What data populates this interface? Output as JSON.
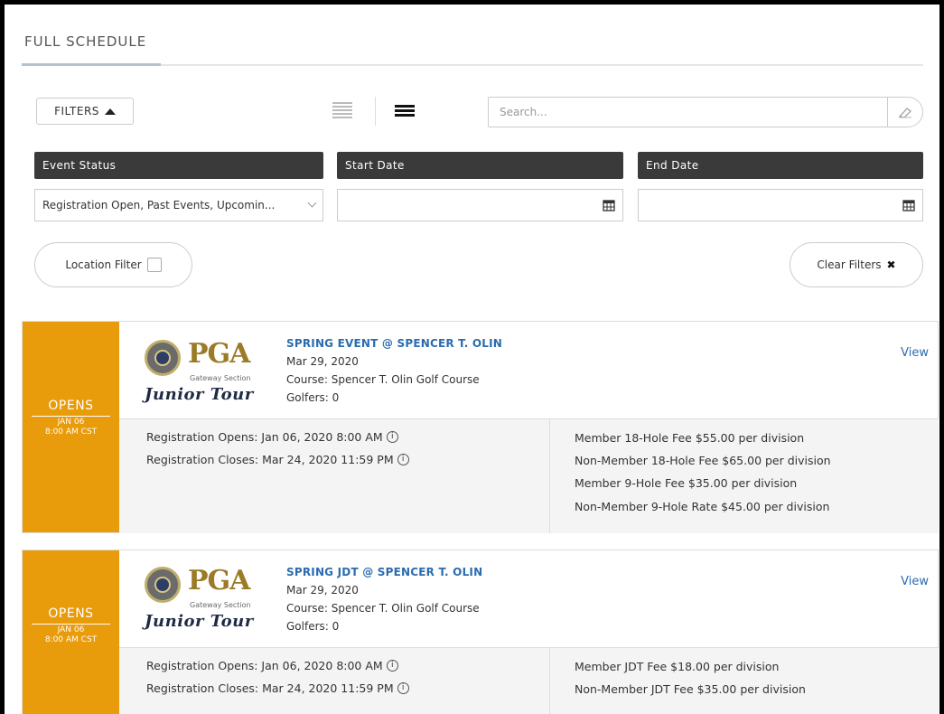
{
  "tab": {
    "title": "FULL SCHEDULE"
  },
  "toolbar": {
    "filters_label": "FILTERS",
    "search_placeholder": "Search..."
  },
  "filters": {
    "event_status_header": "Event Status",
    "start_date_header": "Start Date",
    "end_date_header": "End Date",
    "event_status_value": "Registration Open, Past Events, Upcomin...",
    "start_date_value": "",
    "end_date_value": "",
    "location_filter_label": "Location Filter",
    "clear_filters_label": "Clear Filters"
  },
  "events": [
    {
      "opens_label": "OPENS",
      "opens_date": "JAN 06",
      "opens_time": "8:00 AM CST",
      "logo_pga": "PGA",
      "logo_section": "Gateway Section",
      "logo_tour": "Junior Tour",
      "title": "SPRING EVENT @ SPENCER T. OLIN",
      "date": "Mar 29, 2020",
      "course": "Course: Spencer T. Olin Golf Course",
      "golfers": "Golfers: 0",
      "view_label": "View",
      "registration_opens": "Registration Opens: Jan 06, 2020 8:00 AM",
      "registration_closes": "Registration Closes: Mar 24, 2020 11:59 PM",
      "fees": [
        "Member 18-Hole Fee $55.00 per division",
        "Non-Member 18-Hole Fee $65.00 per division",
        "Member 9-Hole Fee $35.00 per division",
        "Non-Member 9-Hole Rate $45.00 per division"
      ]
    },
    {
      "opens_label": "OPENS",
      "opens_date": "JAN 06",
      "opens_time": "8:00 AM CST",
      "logo_pga": "PGA",
      "logo_section": "Gateway Section",
      "logo_tour": "Junior Tour",
      "title": "SPRING JDT @ SPENCER T. OLIN",
      "date": "Mar 29, 2020",
      "course": "Course: Spencer T. Olin Golf Course",
      "golfers": "Golfers: 0",
      "view_label": "View",
      "registration_opens": "Registration Opens: Jan 06, 2020 8:00 AM",
      "registration_closes": "Registration Closes: Mar 24, 2020 11:59 PM",
      "fees": [
        "Member JDT Fee $18.00 per division",
        "Non-Member JDT Fee $35.00 per division"
      ]
    }
  ],
  "colors": {
    "opens_bg": "#e89b0b",
    "header_bg": "#3a3a3a",
    "link": "#2b6cb0"
  }
}
